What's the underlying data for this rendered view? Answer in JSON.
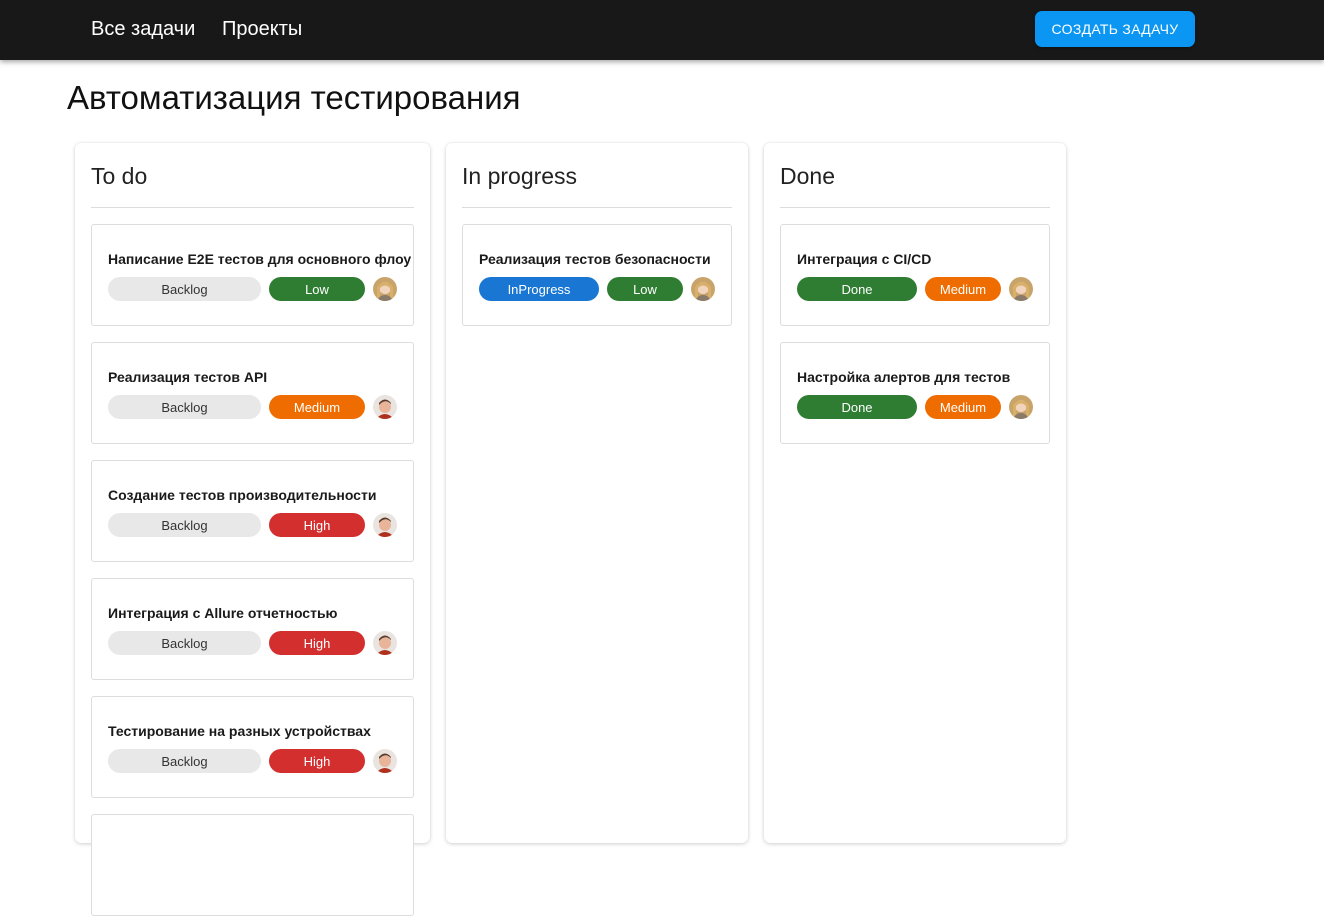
{
  "nav": {
    "all_tasks": "Все задачи",
    "projects": "Проекты",
    "create_task": "СОЗДАТЬ ЗАДАЧУ"
  },
  "page": {
    "title": "Автоматизация тестирования"
  },
  "columns": [
    {
      "title": "To do",
      "cards": [
        {
          "title": "Написание E2E тестов для основного флоу",
          "status": "Backlog",
          "priority": "Low",
          "avatar": "blonde-avatar"
        },
        {
          "title": "Реализация тестов API",
          "status": "Backlog",
          "priority": "Medium",
          "avatar": "man-avatar"
        },
        {
          "title": "Создание тестов производительности",
          "status": "Backlog",
          "priority": "High",
          "avatar": "man-avatar"
        },
        {
          "title": "Интеграция с Allure отчетностью",
          "status": "Backlog",
          "priority": "High",
          "avatar": "man-avatar"
        },
        {
          "title": "Тестирование на разных устройствах",
          "status": "Backlog",
          "priority": "High",
          "avatar": "man-avatar"
        }
      ]
    },
    {
      "title": "In progress",
      "cards": [
        {
          "title": "Реализация тестов безопасности",
          "status": "InProgress",
          "priority": "Low",
          "avatar": "blonde-avatar"
        }
      ]
    },
    {
      "title": "Done",
      "cards": [
        {
          "title": "Интеграция с CI/CD",
          "status": "Done",
          "priority": "Medium",
          "avatar": "blonde-avatar"
        },
        {
          "title": "Настройка алертов для тестов",
          "status": "Done",
          "priority": "Medium",
          "avatar": "blonde-avatar"
        }
      ]
    }
  ],
  "colors": {
    "topbar": "#181818",
    "create_button": "#0a96f2",
    "backlog": "#e8e8e8",
    "low": "#2e7d32",
    "medium": "#ef6c00",
    "high": "#d32f2f",
    "done": "#2e7d32",
    "in_progress": "#1976d2"
  }
}
